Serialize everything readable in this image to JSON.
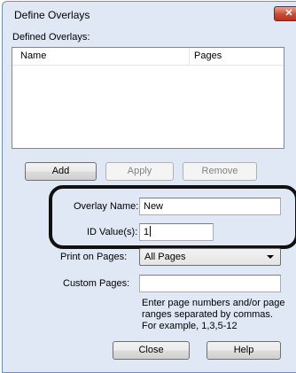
{
  "window": {
    "title": "Define Overlays",
    "close_glyph": "✕"
  },
  "defined_overlays": {
    "label": "Defined Overlays:",
    "columns": [
      "Name",
      "Pages"
    ]
  },
  "buttons": {
    "add": "Add",
    "apply": "Apply",
    "remove": "Remove",
    "close": "Close",
    "help": "Help"
  },
  "overlay_name": {
    "label": "Overlay Name:",
    "value": "New"
  },
  "id_values": {
    "label": "ID Value(s):",
    "value": "1"
  },
  "print_on_pages": {
    "label": "Print on Pages:",
    "selected": "All Pages"
  },
  "custom_pages": {
    "label": "Custom Pages:",
    "value": ""
  },
  "hint": "Enter page numbers and/or page ranges separated by commas. For example, 1,3,5-12",
  "colors": {
    "highlight": "#111111",
    "titlebar": "#dfe8f4",
    "close_red": "#c74a35"
  }
}
